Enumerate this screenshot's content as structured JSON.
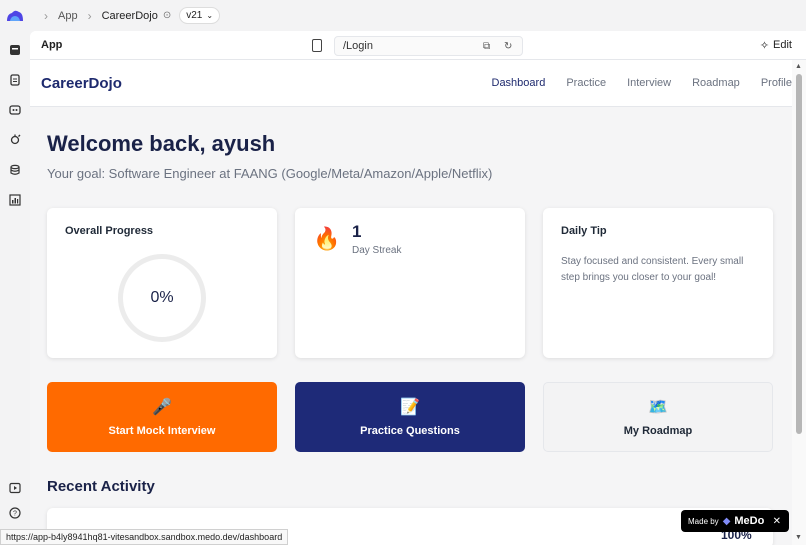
{
  "topbar": {
    "crumb_app": "App",
    "crumb_project": "CareerDojo",
    "version": "v21"
  },
  "toolbar": {
    "app_label": "App",
    "url": "/Login",
    "edit_label": "Edit"
  },
  "nav": {
    "brand": "CareerDojo",
    "links": [
      "Dashboard",
      "Practice",
      "Interview",
      "Roadmap",
      "Profile"
    ],
    "active": "Dashboard"
  },
  "hero": {
    "title": "Welcome back, ayush",
    "goal": "Your goal: Software Engineer at FAANG (Google/Meta/Amazon/Apple/Netflix)"
  },
  "progress_card": {
    "title": "Overall Progress",
    "value": "0%"
  },
  "streak_card": {
    "icon": "fire-icon",
    "count": "1",
    "label": "Day Streak"
  },
  "tip_card": {
    "title": "Daily Tip",
    "text": "Stay focused and consistent. Every small step brings you closer to your goal!"
  },
  "actions": [
    {
      "label": "Start Mock Interview",
      "icon": "🎤",
      "bg": "#ff6a00",
      "color": "#ffffff"
    },
    {
      "label": "Practice Questions",
      "icon": "📝",
      "bg": "#1e2a78",
      "color": "#ffffff"
    },
    {
      "label": "My Roadmap",
      "icon": "🗺️",
      "bg": "#f3f3f4",
      "color": "#1f2937"
    }
  ],
  "recent": {
    "title": "Recent Activity",
    "partial_value": "100%"
  },
  "status_url": "https://app-b4ly8941hq81-vitesandbox.sandbox.medo.dev/dashboard",
  "badge": {
    "made_by": "Made by",
    "brand": "MeDo",
    "close": "✕"
  },
  "colors": {
    "brand_navy": "#1e2a6e",
    "accent_orange": "#ff6a00",
    "accent_blue": "#1e2a78"
  }
}
